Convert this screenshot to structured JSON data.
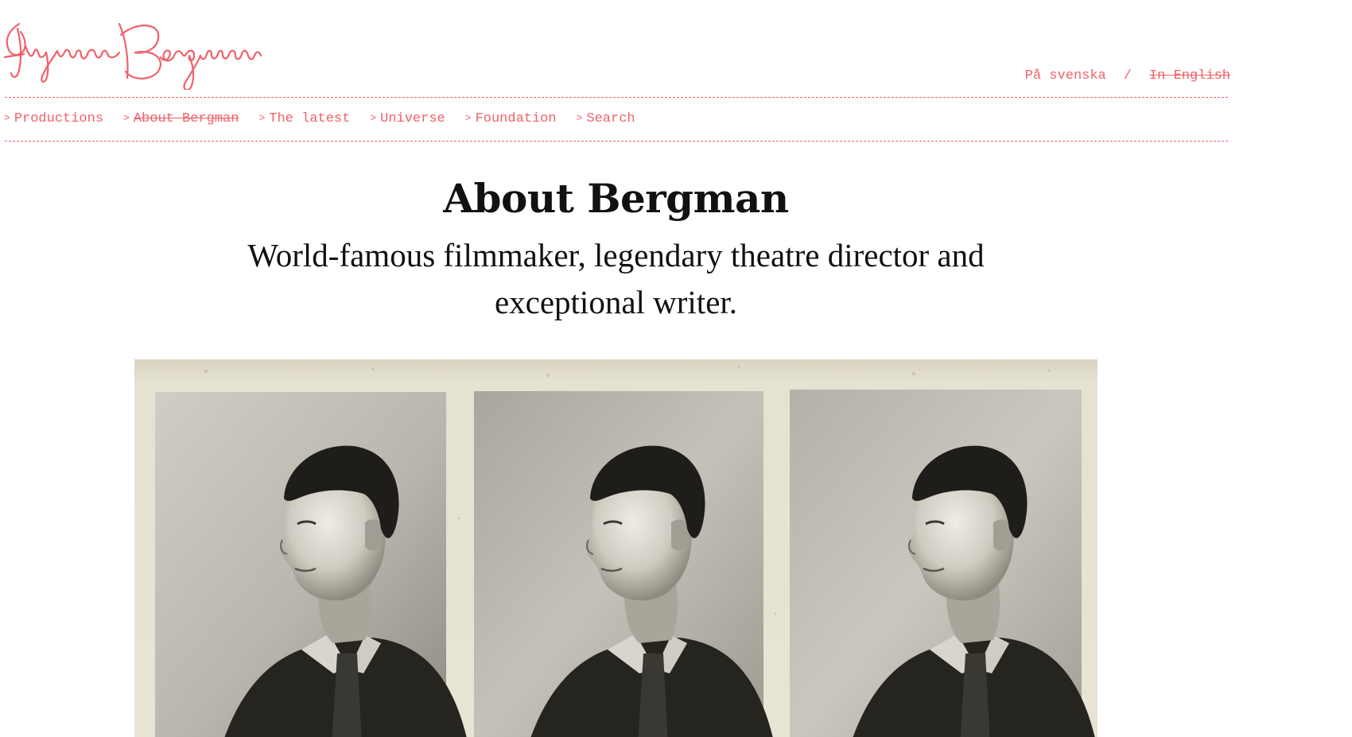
{
  "site": {
    "logo_text": "Ingmar Bergman",
    "accent_color": "#f0616a",
    "text_color": "#111111"
  },
  "language_switch": {
    "swedish": "På svenska",
    "separator": "/",
    "english": "In English"
  },
  "nav": {
    "chevron": ">",
    "items": [
      {
        "label": "Productions",
        "active": false
      },
      {
        "label": "About Bergman",
        "active": true
      },
      {
        "label": "The latest",
        "active": false
      },
      {
        "label": "Universe",
        "active": false
      },
      {
        "label": "Foundation",
        "active": false
      },
      {
        "label": "Search",
        "active": false
      }
    ]
  },
  "main": {
    "title": "About Bergman",
    "subtitle": "World-famous filmmaker, legendary theatre director and exceptional writer."
  },
  "hero_image": {
    "description_icon": "photo-booth-strip",
    "frame_count": 3
  }
}
